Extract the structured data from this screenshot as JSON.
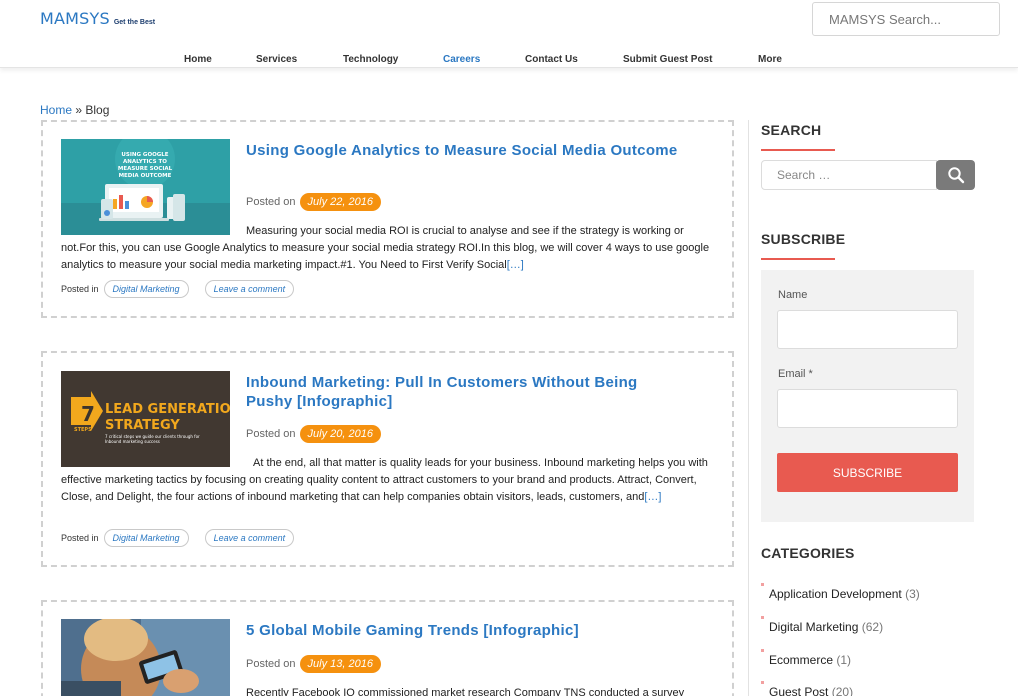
{
  "logo": {
    "name": "MAMSYS",
    "tagline": "Get the Best"
  },
  "header_search": {
    "placeholder": "MAMSYS Search..."
  },
  "nav": [
    "Home",
    "Services",
    "Technology",
    "Careers",
    "Contact Us",
    "Submit Guest Post",
    "More"
  ],
  "nav_active": "Careers",
  "breadcrumb": {
    "home": "Home",
    "separator": "»",
    "current": "Blog"
  },
  "posts": [
    {
      "title": "Using Google Analytics to Measure Social Media Outcome",
      "posted_label": "Posted on",
      "date": "July 22, 2016",
      "thumb_text": "USING GOOGLE ANALYTICS TO MEASURE SOCIAL MEDIA OUTCOME",
      "excerpt": "Measuring your social media ROI is crucial to analyse and see if the strategy is working or not.For this, you can use Google Analytics to measure your social media strategy ROI.In this blog, we will cover 4 ways to use google analytics to measure your social media marketing impact.#1. You Need to First Verify Social",
      "more": "[…]",
      "posted_in_label": "Posted in",
      "category": "Digital Marketing",
      "comment": "Leave a comment"
    },
    {
      "title": "Inbound Marketing: Pull In Customers Without Being Pushy [Infographic]",
      "posted_label": "Posted on",
      "date": "July 20, 2016",
      "thumb_number": "7",
      "thumb_steps": "STEPS",
      "thumb_title_1": "LEAD GENERATION",
      "thumb_title_2": "STRATEGY",
      "thumb_sub": "7 critical steps we guide our clients through for Inbound marketing success",
      "excerpt": "At the end, all that matter is quality leads for your business. Inbound marketing helps you with effective marketing tactics by focusing on creating quality content to attract customers to your brand and products. Attract, Convert, Close, and Delight, the four actions of inbound marketing that can help companies obtain visitors, leads, customers, and",
      "more": "[…]",
      "posted_in_label": "Posted in",
      "category": "Digital Marketing",
      "comment": "Leave a comment"
    },
    {
      "title": "5 Global Mobile Gaming Trends [Infographic]",
      "posted_label": "Posted on",
      "date": "July 13, 2016",
      "excerpt": "Recently Facebook IQ commissioned market research Company TNS conducted a survey"
    }
  ],
  "sidebar": {
    "search_title": "SEARCH",
    "search_placeholder": "Search …",
    "subscribe_title": "SUBSCRIBE",
    "name_label": "Name",
    "email_label": "Email *",
    "subscribe_button": "SUBSCRIBE",
    "categories_title": "CATEGORIES",
    "categories": [
      {
        "name": "Application Development",
        "count": "(3)"
      },
      {
        "name": "Digital Marketing",
        "count": "(62)"
      },
      {
        "name": "Ecommerce",
        "count": "(1)"
      },
      {
        "name": "Guest Post",
        "count": "(20)"
      }
    ]
  },
  "colors": {
    "brand_blue": "#2b78c2",
    "date_orange": "#f5910f",
    "accent_red": "#e85a50"
  }
}
